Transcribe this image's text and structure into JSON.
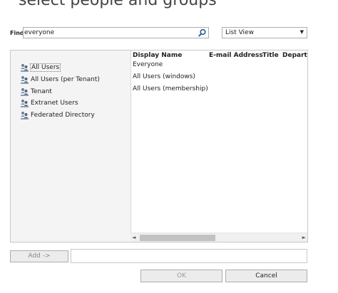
{
  "dialog": {
    "title": "select people and groups"
  },
  "find": {
    "label": "Find",
    "value": "everyone",
    "search_icon": "magnifier-icon"
  },
  "view": {
    "selected": "List View",
    "arrow": "▼"
  },
  "tree": {
    "items": [
      {
        "label": "All Users",
        "icon": "directory-icon",
        "selected": true
      },
      {
        "label": "All Users (per Tenant)",
        "icon": "directory-icon",
        "selected": false
      },
      {
        "label": "Tenant",
        "icon": "directory-icon",
        "selected": false
      },
      {
        "label": "Extranet Users",
        "icon": "directory-icon",
        "selected": false
      },
      {
        "label": "Federated Directory",
        "icon": "directory-icon",
        "selected": false
      }
    ]
  },
  "results": {
    "columns": [
      "Display Name",
      "E-mail Address",
      "Title",
      "Departn"
    ],
    "rows": [
      {
        "display_name": "Everyone"
      },
      {
        "display_name": "All Users (windows)"
      },
      {
        "display_name": "All Users (membership)"
      }
    ]
  },
  "scrollbar": {
    "left_arrow": "◄",
    "right_arrow": "►"
  },
  "add": {
    "label": "Add ->",
    "value": ""
  },
  "footer": {
    "ok_label": "OK",
    "cancel_label": "Cancel"
  },
  "colors": {
    "selection_border": "#777777",
    "tree_bg": "#f4f4f4",
    "scroll_thumb": "#c2c2c2"
  }
}
